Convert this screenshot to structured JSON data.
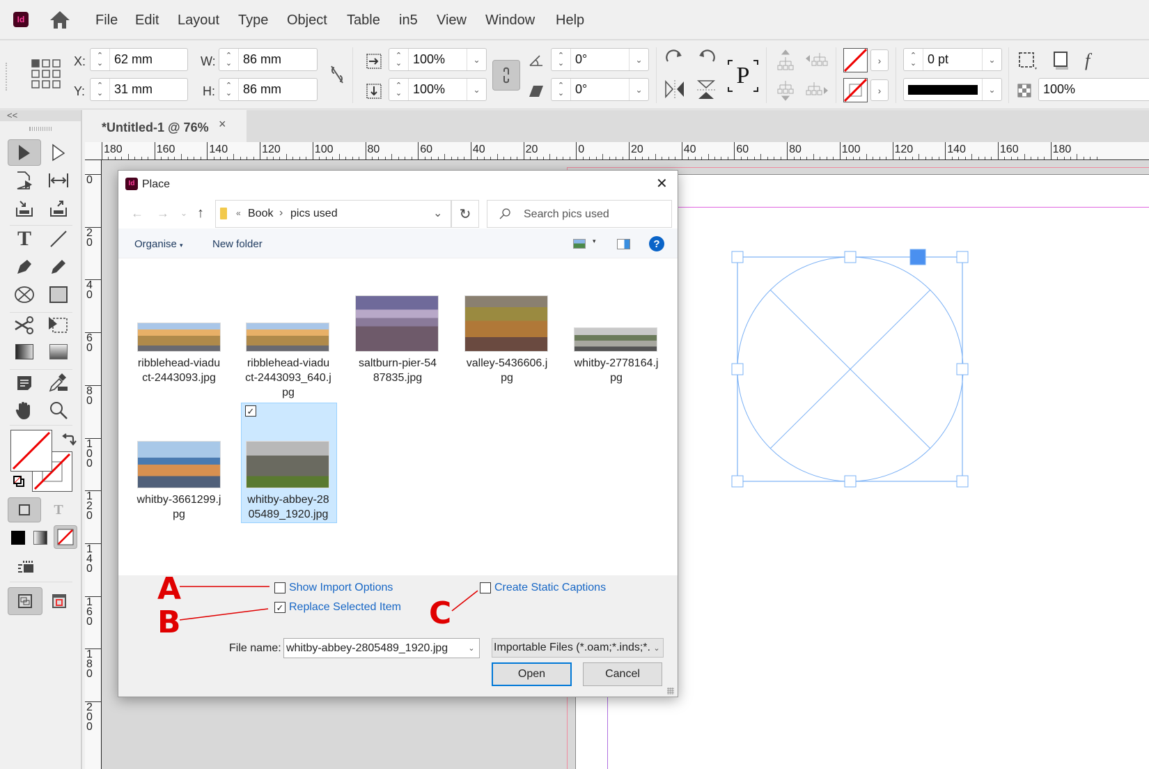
{
  "app": {
    "logo_text": "Id",
    "name": "Adobe InDesign"
  },
  "menu": [
    "File",
    "Edit",
    "Layout",
    "Type",
    "Object",
    "Table",
    "in5",
    "View",
    "Window",
    "Help"
  ],
  "control": {
    "x_label": "X:",
    "x_value": "62 mm",
    "y_label": "Y:",
    "y_value": "31 mm",
    "w_label": "W:",
    "w_value": "86 mm",
    "h_label": "H:",
    "h_value": "86 mm",
    "scale_x": "100%",
    "scale_y": "100%",
    "rotate": "0°",
    "shear": "0°",
    "stroke_weight": "0 pt",
    "opacity": "100%"
  },
  "tools_panel": {
    "collapse_label": "<<"
  },
  "document_tab": {
    "title": "*Untitled-1 @ 76%",
    "close": "×"
  },
  "h_ruler": [
    "180",
    "160",
    "140",
    "120",
    "100",
    "80",
    "60",
    "40",
    "20",
    "0",
    "20",
    "40",
    "60",
    "80",
    "100",
    "120",
    "140",
    "160",
    "180"
  ],
  "v_ruler": [
    "0",
    "2\n0",
    "4\n0",
    "6\n0",
    "8\n0",
    "1\n0\n0",
    "1\n2\n0",
    "1\n4\n0",
    "1\n6\n0",
    "1\n8\n0",
    "2\n0\n0"
  ],
  "dialog": {
    "title": "Place",
    "close": "✕",
    "path": {
      "overflow": "«",
      "crumbs": [
        "Book",
        "pics used"
      ]
    },
    "search_placeholder": "Search pics used",
    "organise_label": "Organise",
    "new_folder_label": "New folder",
    "help_label": "?",
    "files": [
      {
        "name": "ribblehead-viaduct-2443093.jpg",
        "line1": "ribblehead-viadu",
        "line2": "ct-2443093.jpg",
        "line3": "",
        "selected": false
      },
      {
        "name": "ribblehead-viaduct-2443093_640.jpg",
        "line1": "ribblehead-viadu",
        "line2": "ct-2443093_640.j",
        "line3": "pg",
        "selected": false
      },
      {
        "name": "saltburn-pier-5487835.jpg",
        "line1": "saltburn-pier-54",
        "line2": "87835.jpg",
        "line3": "",
        "selected": false
      },
      {
        "name": "valley-5436606.jpg",
        "line1": "valley-5436606.j",
        "line2": "pg",
        "line3": "",
        "selected": false
      },
      {
        "name": "whitby-2778164.jpg",
        "line1": "whitby-2778164.j",
        "line2": "pg",
        "line3": "",
        "selected": false
      },
      {
        "name": "whitby-3661299.jpg",
        "line1": "whitby-3661299.j",
        "line2": "pg",
        "line3": "",
        "selected": false
      },
      {
        "name": "whitby-abbey-2805489_1920.jpg",
        "line1": "whitby-abbey-28",
        "line2": "05489_1920.jpg",
        "line3": "",
        "selected": true
      }
    ],
    "options": {
      "show_import_options": {
        "label": "Show Import Options",
        "checked": false
      },
      "replace_selected_item": {
        "label": "Replace Selected Item",
        "checked": true
      },
      "create_static_captions": {
        "label": "Create Static Captions",
        "checked": false
      }
    },
    "file_name_label": "File name:",
    "file_name_value": "whitby-abbey-2805489_1920.jpg",
    "file_type": "Importable Files (*.oam;*.inds;*.i",
    "open_label": "Open",
    "cancel_label": "Cancel"
  },
  "annotations": {
    "a": "A",
    "b": "B",
    "c": "C"
  },
  "colors": {
    "annotation_red": "#e00000",
    "selection_blue": "#4a90f0",
    "dialog_link_blue": "#1666c5",
    "margin_magenta": "#e066e0"
  }
}
